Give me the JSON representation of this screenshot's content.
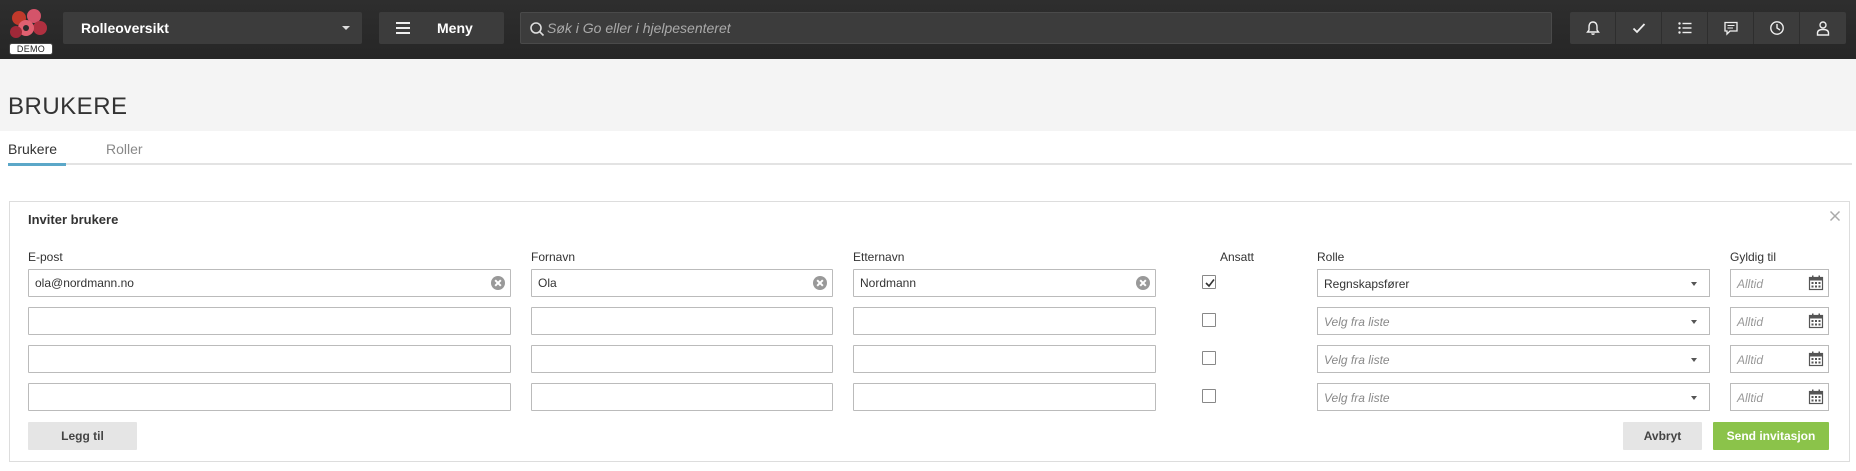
{
  "topbar": {
    "logo_badge": "DEMO",
    "role_select_label": "Rolleoversikt",
    "menu_label": "Meny",
    "search_placeholder": "Søk i Go eller i hjelpesenteret",
    "icons": [
      "bell-icon",
      "check-icon",
      "list-icon",
      "chat-icon",
      "clock-icon",
      "user-icon"
    ]
  },
  "page": {
    "title": "BRUKERE",
    "tabs": [
      {
        "label": "Brukere",
        "active": true
      },
      {
        "label": "Roller",
        "active": false
      }
    ]
  },
  "invite": {
    "title": "Inviter brukere",
    "columns": {
      "email": "E-post",
      "firstname": "Fornavn",
      "lastname": "Etternavn",
      "employee": "Ansatt",
      "role": "Rolle",
      "valid_until": "Gyldig til"
    },
    "rows": [
      {
        "email": "ola@nordmann.no",
        "firstname": "Ola",
        "lastname": "Nordmann",
        "employee": true,
        "role": "Regnskapsfører",
        "valid_until": "Alltid"
      },
      {
        "email": "",
        "firstname": "",
        "lastname": "",
        "employee": false,
        "role": "Velg fra liste",
        "valid_until": "Alltid"
      },
      {
        "email": "",
        "firstname": "",
        "lastname": "",
        "employee": false,
        "role": "Velg fra liste",
        "valid_until": "Alltid"
      },
      {
        "email": "",
        "firstname": "",
        "lastname": "",
        "employee": false,
        "role": "Velg fra liste",
        "valid_until": "Alltid"
      }
    ],
    "add_button": "Legg til",
    "cancel_button": "Avbryt",
    "send_button": "Send invitasjon"
  },
  "colors": {
    "topbar_bg": "#2b2b2b",
    "tab_accent": "#5ba7c8",
    "send_button": "#8bc34a"
  }
}
